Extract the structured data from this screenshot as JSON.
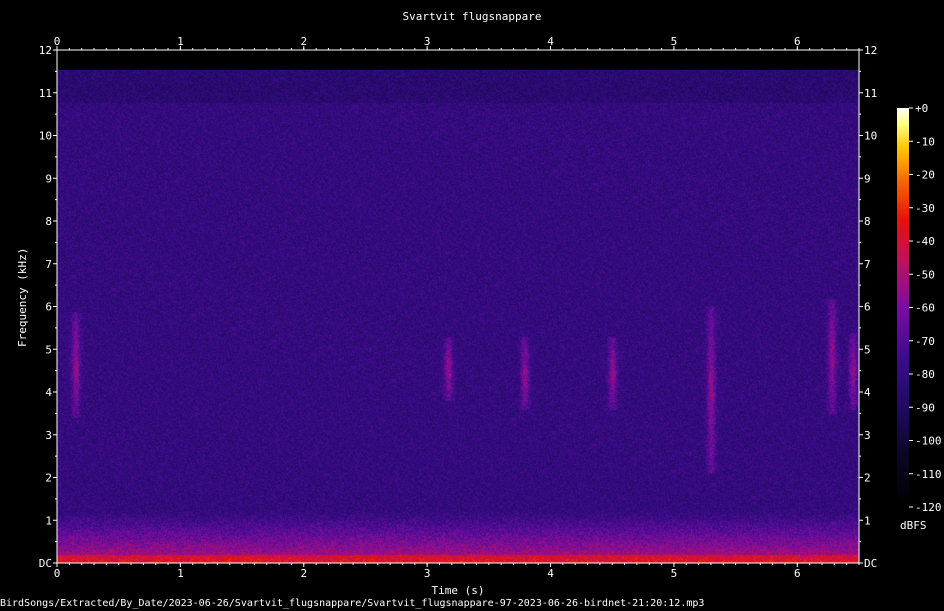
{
  "chart_data": {
    "type": "heatmap",
    "title": "Svartvit flugsnappare",
    "xlabel": "Time (s)",
    "ylabel": "Frequency (kHz)",
    "x_ticks": [
      "0",
      "1",
      "2",
      "3",
      "4",
      "5",
      "6"
    ],
    "x_tick_values": [
      0,
      1,
      2,
      3,
      4,
      5,
      6
    ],
    "y_ticks": [
      "DC",
      "1",
      "2",
      "3",
      "4",
      "5",
      "6",
      "7",
      "8",
      "9",
      "10",
      "11",
      "12"
    ],
    "y_tick_values": [
      0,
      1,
      2,
      3,
      4,
      5,
      6,
      7,
      8,
      9,
      10,
      11,
      12
    ],
    "xlim": [
      0,
      6.5
    ],
    "ylim": [
      0,
      12
    ],
    "colorbar": {
      "label": "dBFS",
      "ticks": [
        "+0",
        "-10",
        "-20",
        "-30",
        "-40",
        "-50",
        "-60",
        "-70",
        "-80",
        "-90",
        "-100",
        "-110",
        "-120"
      ],
      "tick_values": [
        0,
        -10,
        -20,
        -30,
        -40,
        -50,
        -60,
        -70,
        -80,
        -90,
        -100,
        -110,
        -120
      ],
      "range": [
        -120,
        0
      ]
    },
    "events": [
      {
        "t": 0.15,
        "f_low": 3.4,
        "f_high": 5.9
      },
      {
        "t": 3.17,
        "f_low": 3.8,
        "f_high": 5.3
      },
      {
        "t": 3.79,
        "f_low": 3.6,
        "f_high": 5.3
      },
      {
        "t": 4.5,
        "f_low": 3.6,
        "f_high": 5.3
      },
      {
        "t": 5.3,
        "f_low": 2.1,
        "f_high": 6.0
      },
      {
        "t": 6.28,
        "f_low": 3.5,
        "f_high": 6.2
      },
      {
        "t": 6.45,
        "f_low": 3.6,
        "f_high": 5.4
      }
    ],
    "max_frequency_with_energy": 11.55
  },
  "footer": "BirdSongs/Extracted/By_Date/2023-06-26/Svartvit_flugsnappare/Svartvit_flugsnappare-97-2023-06-26-birdnet-21:20:12.mp3"
}
